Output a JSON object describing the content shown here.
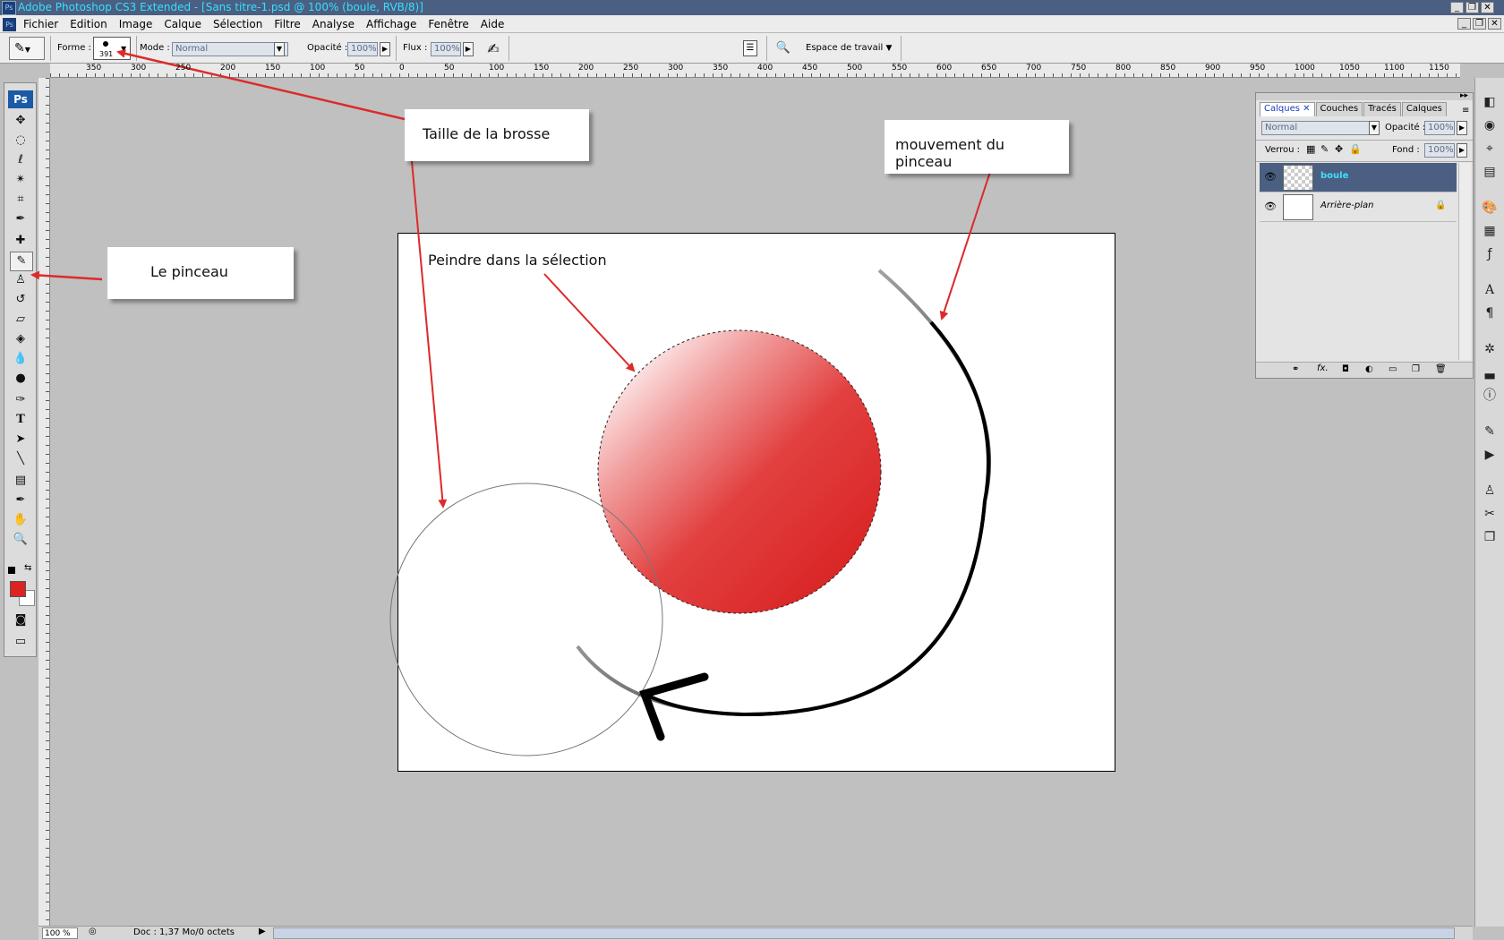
{
  "app": {
    "title": "Adobe Photoshop CS3 Extended - [Sans titre-1.psd @ 100% (boule, RVB/8)]",
    "icon_label": "Ps"
  },
  "menu": [
    "Fichier",
    "Edition",
    "Image",
    "Calque",
    "Sélection",
    "Filtre",
    "Analyse",
    "Affichage",
    "Fenêtre",
    "Aide"
  ],
  "options": {
    "forme_label": "Forme :",
    "brush_size": "391",
    "mode_label": "Mode :",
    "mode_value": "Normal",
    "opacite_label": "Opacité :",
    "opacite_value": "100%",
    "flux_label": "Flux :",
    "flux_value": "100%",
    "workspace_label": "Espace de travail"
  },
  "ruler_ticks": [
    "350",
    "300",
    "250",
    "200",
    "150",
    "100",
    "50",
    "0",
    "50",
    "100",
    "150",
    "200",
    "250",
    "300",
    "350",
    "400",
    "450",
    "500",
    "550",
    "600",
    "650",
    "700",
    "750",
    "800",
    "850",
    "900",
    "950",
    "1000",
    "1050",
    "1100",
    "1150"
  ],
  "tools": {
    "ps_label": "Ps",
    "items": [
      "move-tool",
      "marquee-ellipse-tool",
      "lasso-tool",
      "magic-wand-tool",
      "crop-tool",
      "eyedropper-tool",
      "healing-tool",
      "brush-tool",
      "stamp-tool",
      "history-brush-tool",
      "eraser-tool",
      "bucket-tool",
      "blur-tool",
      "dodge-tool",
      "pen-tool",
      "type-tool",
      "path-select-tool",
      "line-tool",
      "notes-tool",
      "eyedropper2-tool",
      "hand-tool",
      "zoom-tool"
    ],
    "foreground_color": "#dd2222",
    "background_color": "#ffffff"
  },
  "callouts": {
    "brush_size": "Taille de la brosse",
    "brush_tool": "Le pinceau",
    "brush_motion": "mouvement du pinceau",
    "paint_selection": "Peindre dans la sélection"
  },
  "layers_panel": {
    "tabs": [
      "Calques",
      "Couches",
      "Tracés",
      "Calques"
    ],
    "blend_mode": "Normal",
    "opacity_label": "Opacité :",
    "opacity_value": "100%",
    "lock_label": "Verrou :",
    "fill_label": "Fond :",
    "fill_value": "100%",
    "layers": [
      {
        "name": "boule",
        "selected": true
      },
      {
        "name": "Arrière-plan",
        "selected": false,
        "locked": true
      }
    ]
  },
  "status": {
    "zoom": "100 %",
    "doc": "Doc : 1,37 Mo/0 octets"
  },
  "colors": {
    "accent_red": "#dd2a2a",
    "titlebar_bg": "#4a5f82",
    "titlebar_text": "#35e0ff",
    "arrow_red": "#dd2a2a"
  }
}
